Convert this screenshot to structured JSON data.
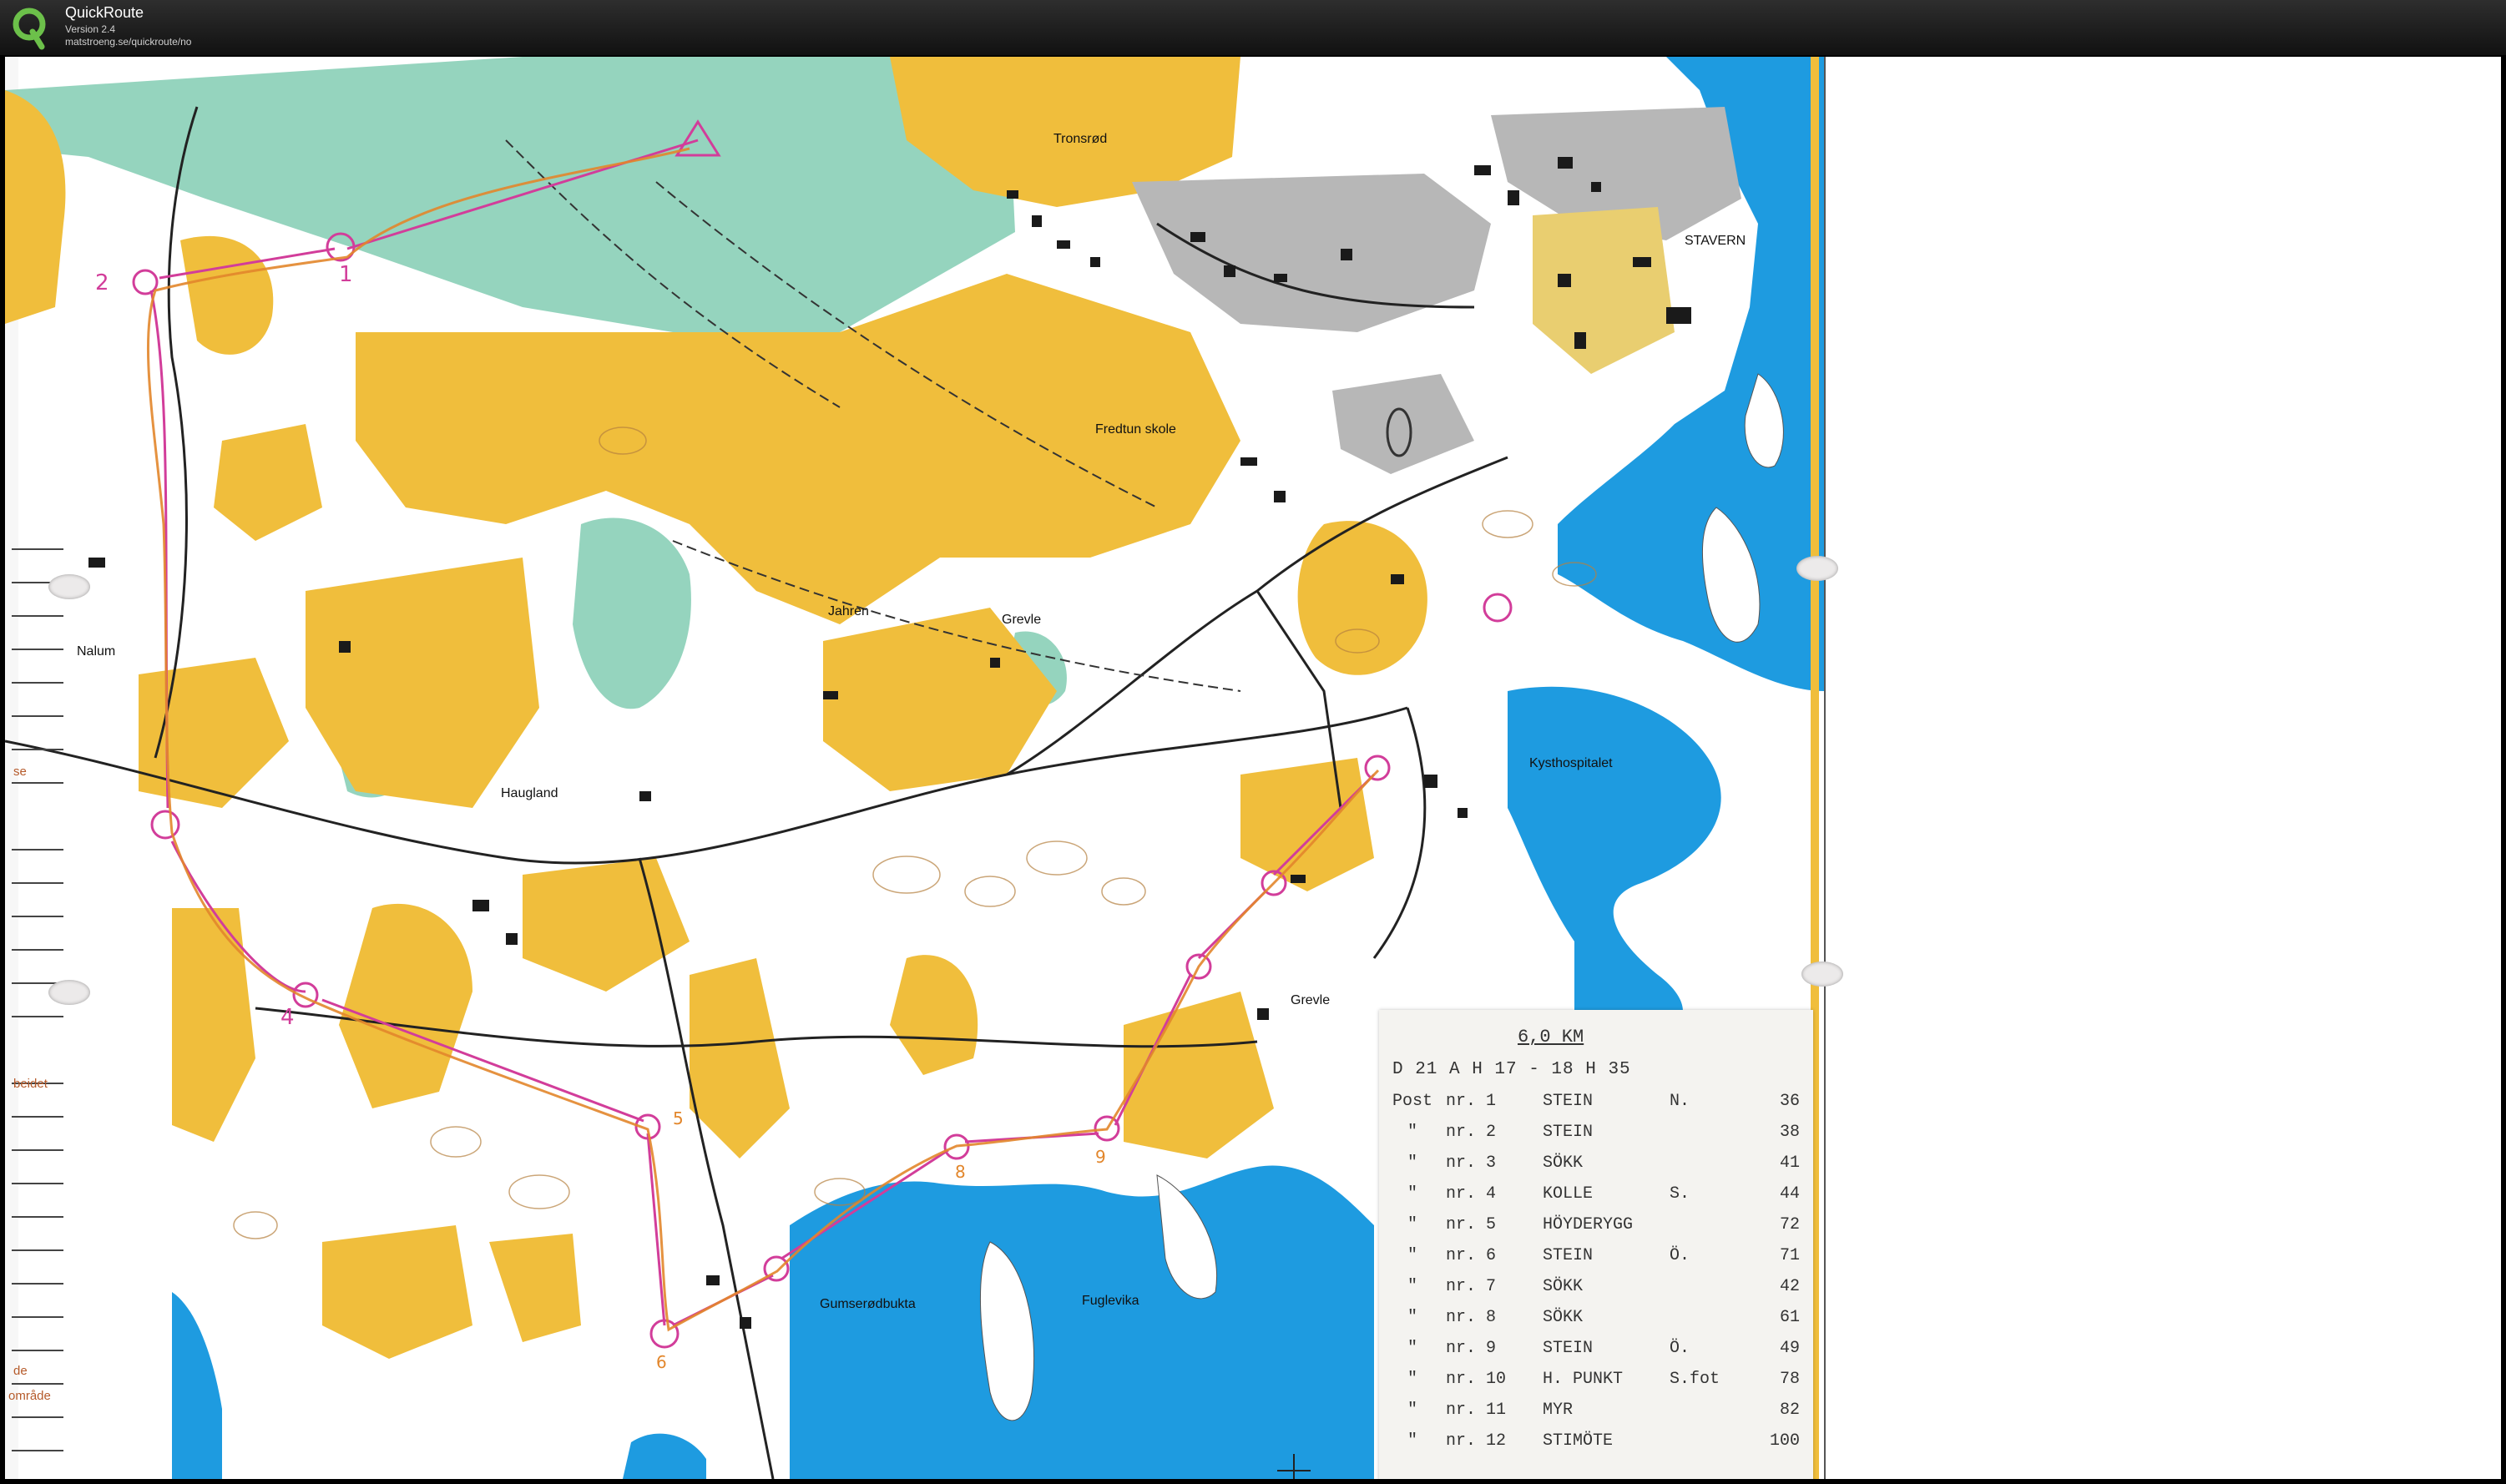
{
  "window": {
    "title": "QuickRoute",
    "version": "Version 2.4",
    "url": "matstroeng.se/quickroute/no"
  },
  "colors": {
    "open_land": "#f0be3c",
    "forest_green": "#8fd2ba",
    "water": "#1e9be0",
    "urban": "#b7b7b7",
    "course": "#d23d9a",
    "route": "#e2862b"
  },
  "map": {
    "places": [
      {
        "id": "tronsrod",
        "label": "Tronsrød"
      },
      {
        "id": "stavern",
        "label": "STAVERN"
      },
      {
        "id": "fredtun",
        "label": "Fredtun skole"
      },
      {
        "id": "nalum",
        "label": "Nalum"
      },
      {
        "id": "jahren",
        "label": "Jahren"
      },
      {
        "id": "grevle1",
        "label": "Grevle"
      },
      {
        "id": "kysthospitalet",
        "label": "Kysthospitalet"
      },
      {
        "id": "haugland",
        "label": "Haugland"
      },
      {
        "id": "grevle2",
        "label": "Grevle"
      },
      {
        "id": "gumserodbukta",
        "label": "Gumserødbukta"
      },
      {
        "id": "fuglevika",
        "label": "Fuglevika"
      }
    ],
    "legend_fragments": [
      "se",
      "beidet",
      "de",
      "område"
    ],
    "control_numbers": [
      "1",
      "2",
      "4",
      "5",
      "6",
      "8",
      "9"
    ]
  },
  "description_sheet": {
    "distance": "6,0 KM",
    "classes": "D 21 A  H 17 - 18  H 35",
    "controls": [
      {
        "prefix": "Post",
        "nr": "nr.  1",
        "desc": "STEIN",
        "mod": "N.",
        "code": "36"
      },
      {
        "prefix": "\"",
        "nr": "nr.  2",
        "desc": "STEIN",
        "mod": "",
        "code": "38"
      },
      {
        "prefix": "\"",
        "nr": "nr.  3",
        "desc": "SÖKK",
        "mod": "",
        "code": "41"
      },
      {
        "prefix": "\"",
        "nr": "nr.  4",
        "desc": "KOLLE",
        "mod": "S.",
        "code": "44"
      },
      {
        "prefix": "\"",
        "nr": "nr.  5",
        "desc": "HÖYDERYGG",
        "mod": "",
        "code": "72"
      },
      {
        "prefix": "\"",
        "nr": "nr.  6",
        "desc": "STEIN",
        "mod": "Ö.",
        "code": "71"
      },
      {
        "prefix": "\"",
        "nr": "nr.  7",
        "desc": "SÖKK",
        "mod": "",
        "code": "42"
      },
      {
        "prefix": "\"",
        "nr": "nr.  8",
        "desc": "SÖKK",
        "mod": "",
        "code": "61"
      },
      {
        "prefix": "\"",
        "nr": "nr.  9",
        "desc": "STEIN",
        "mod": "Ö.",
        "code": "49"
      },
      {
        "prefix": "\"",
        "nr": "nr. 10",
        "desc": "H. PUNKT",
        "mod": "S.fot",
        "code": "78"
      },
      {
        "prefix": "\"",
        "nr": "nr. 11",
        "desc": "MYR",
        "mod": "",
        "code": "82"
      },
      {
        "prefix": "\"",
        "nr": "nr. 12",
        "desc": "STIMÖTE",
        "mod": "",
        "code": "100"
      }
    ]
  }
}
